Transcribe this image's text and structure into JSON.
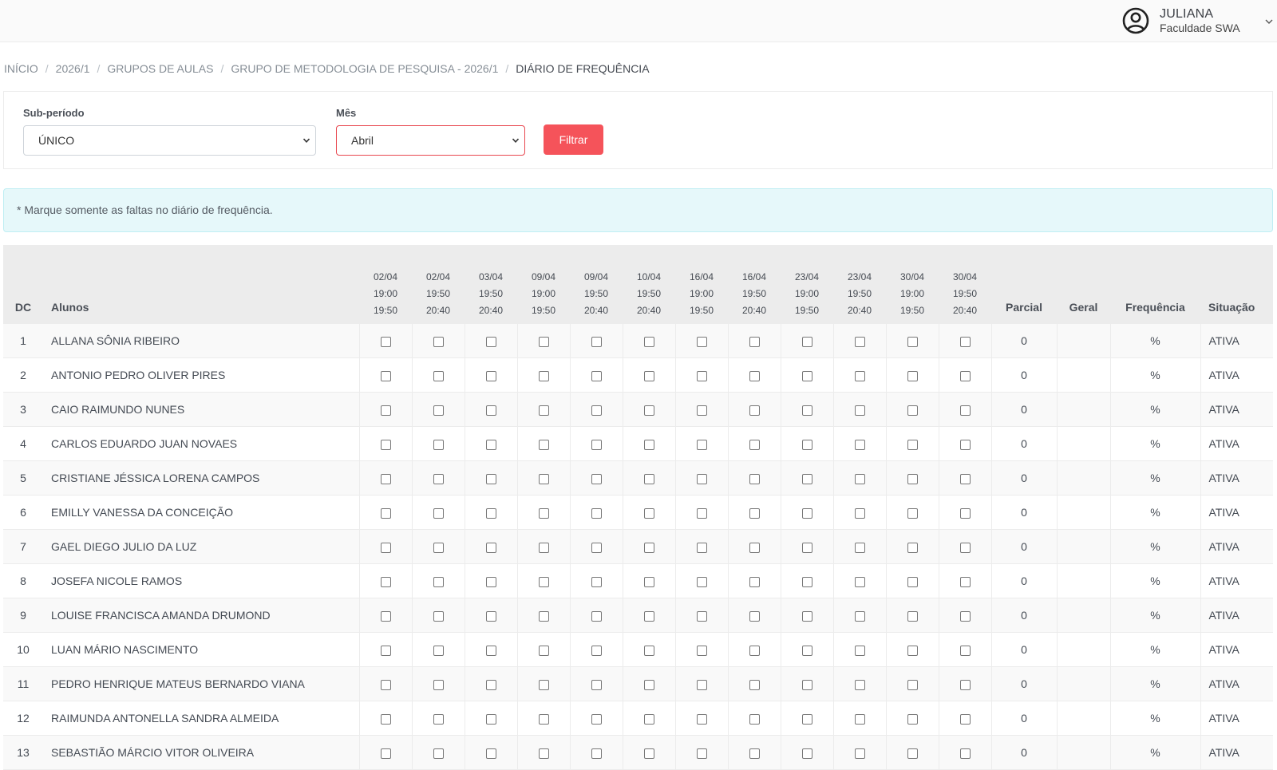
{
  "header": {
    "user_name": "JULIANA",
    "user_org": "Faculdade SWA"
  },
  "breadcrumb": [
    "INÍCIO",
    "2026/1",
    "GRUPOS DE AULAS",
    "GRUPO DE METODOLOGIA DE PESQUISA - 2026/1",
    "DIÁRIO DE FREQUÊNCIA"
  ],
  "filters": {
    "subperiodo_label": "Sub-período",
    "subperiodo_value": "ÚNICO",
    "mes_label": "Mês",
    "mes_value": "Abril",
    "filter_button": "Filtrar"
  },
  "alert": "* Marque somente as faltas no diário de frequência.",
  "table": {
    "headers": {
      "dc": "DC",
      "alunos": "Alunos",
      "parcial": "Parcial",
      "geral": "Geral",
      "frequencia": "Frequência",
      "situacao": "Situação"
    },
    "sessions": [
      {
        "date": "02/04",
        "start": "19:00",
        "end": "19:50"
      },
      {
        "date": "02/04",
        "start": "19:50",
        "end": "20:40"
      },
      {
        "date": "03/04",
        "start": "19:50",
        "end": "20:40"
      },
      {
        "date": "09/04",
        "start": "19:00",
        "end": "19:50"
      },
      {
        "date": "09/04",
        "start": "19:50",
        "end": "20:40"
      },
      {
        "date": "10/04",
        "start": "19:50",
        "end": "20:40"
      },
      {
        "date": "16/04",
        "start": "19:00",
        "end": "19:50"
      },
      {
        "date": "16/04",
        "start": "19:50",
        "end": "20:40"
      },
      {
        "date": "23/04",
        "start": "19:00",
        "end": "19:50"
      },
      {
        "date": "23/04",
        "start": "19:50",
        "end": "20:40"
      },
      {
        "date": "30/04",
        "start": "19:00",
        "end": "19:50"
      },
      {
        "date": "30/04",
        "start": "19:50",
        "end": "20:40"
      }
    ],
    "rows": [
      {
        "dc": "1",
        "name": "ALLANA SÔNIA RIBEIRO",
        "parcial": "0",
        "geral": "",
        "frequencia": "%",
        "situacao": "ATIVA"
      },
      {
        "dc": "2",
        "name": "ANTONIO PEDRO OLIVER PIRES",
        "parcial": "0",
        "geral": "",
        "frequencia": "%",
        "situacao": "ATIVA"
      },
      {
        "dc": "3",
        "name": "CAIO RAIMUNDO NUNES",
        "parcial": "0",
        "geral": "",
        "frequencia": "%",
        "situacao": "ATIVA"
      },
      {
        "dc": "4",
        "name": "CARLOS EDUARDO JUAN NOVAES",
        "parcial": "0",
        "geral": "",
        "frequencia": "%",
        "situacao": "ATIVA"
      },
      {
        "dc": "5",
        "name": "CRISTIANE JÉSSICA LORENA CAMPOS",
        "parcial": "0",
        "geral": "",
        "frequencia": "%",
        "situacao": "ATIVA"
      },
      {
        "dc": "6",
        "name": "EMILLY VANESSA DA CONCEIÇÃO",
        "parcial": "0",
        "geral": "",
        "frequencia": "%",
        "situacao": "ATIVA"
      },
      {
        "dc": "7",
        "name": "GAEL DIEGO JULIO DA LUZ",
        "parcial": "0",
        "geral": "",
        "frequencia": "%",
        "situacao": "ATIVA"
      },
      {
        "dc": "8",
        "name": "JOSEFA NICOLE RAMOS",
        "parcial": "0",
        "geral": "",
        "frequencia": "%",
        "situacao": "ATIVA"
      },
      {
        "dc": "9",
        "name": "LOUISE FRANCISCA AMANDA DRUMOND",
        "parcial": "0",
        "geral": "",
        "frequencia": "%",
        "situacao": "ATIVA"
      },
      {
        "dc": "10",
        "name": "LUAN MÁRIO NASCIMENTO",
        "parcial": "0",
        "geral": "",
        "frequencia": "%",
        "situacao": "ATIVA"
      },
      {
        "dc": "11",
        "name": "PEDRO HENRIQUE MATEUS BERNARDO VIANA",
        "parcial": "0",
        "geral": "",
        "frequencia": "%",
        "situacao": "ATIVA"
      },
      {
        "dc": "12",
        "name": "RAIMUNDA ANTONELLA SANDRA ALMEIDA",
        "parcial": "0",
        "geral": "",
        "frequencia": "%",
        "situacao": "ATIVA"
      },
      {
        "dc": "13",
        "name": "SEBASTIÃO MÁRCIO VITOR OLIVEIRA",
        "parcial": "0",
        "geral": "",
        "frequencia": "%",
        "situacao": "ATIVA"
      }
    ]
  },
  "colors": {
    "accent": "#f5535a",
    "alert_bg": "#e6f8fa",
    "header_bg": "#ececec"
  },
  "icons": {
    "user": "user-circle-icon",
    "chevron": "chevron-down-icon"
  }
}
